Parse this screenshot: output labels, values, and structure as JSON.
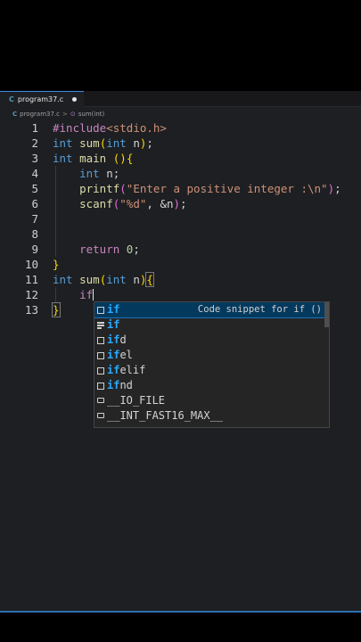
{
  "tab": {
    "icon": "C",
    "name": "program37.c"
  },
  "breadcrumb": {
    "icon": "C",
    "file": "program37.c",
    "sep": ">",
    "symbol": "sum(int)"
  },
  "lines": [
    {
      "n": "1",
      "tokens": [
        [
          "pre",
          "#include"
        ],
        [
          "inc",
          "<stdio.h>"
        ]
      ]
    },
    {
      "n": "2",
      "tokens": [
        [
          "kw",
          "int"
        ],
        [
          "txt",
          " "
        ],
        [
          "fn",
          "sum"
        ],
        [
          "br1",
          "("
        ],
        [
          "kw",
          "int"
        ],
        [
          "txt",
          " n"
        ],
        [
          "br1",
          ")"
        ],
        [
          "txt",
          ";"
        ]
      ]
    },
    {
      "n": "3",
      "tokens": [
        [
          "kw",
          "int"
        ],
        [
          "txt",
          " "
        ],
        [
          "fn",
          "main"
        ],
        [
          "txt",
          " "
        ],
        [
          "br1",
          "()"
        ],
        [
          "br1",
          "{"
        ]
      ]
    },
    {
      "n": "4",
      "tokens": [
        [
          "txt",
          "    "
        ],
        [
          "kw",
          "int"
        ],
        [
          "txt",
          " n;"
        ]
      ]
    },
    {
      "n": "5",
      "tokens": [
        [
          "txt",
          "    "
        ],
        [
          "fn",
          "printf"
        ],
        [
          "br2",
          "("
        ],
        [
          "str",
          "\"Enter a positive integer :\\n\""
        ],
        [
          "br2",
          ")"
        ],
        [
          "txt",
          ";"
        ]
      ]
    },
    {
      "n": "6",
      "tokens": [
        [
          "txt",
          "    "
        ],
        [
          "fn",
          "scanf"
        ],
        [
          "br2",
          "("
        ],
        [
          "str",
          "\"%d\""
        ],
        [
          "txt",
          ", &n"
        ],
        [
          "br2",
          ")"
        ],
        [
          "txt",
          ";"
        ]
      ]
    },
    {
      "n": "7",
      "tokens": []
    },
    {
      "n": "8",
      "tokens": []
    },
    {
      "n": "9",
      "tokens": [
        [
          "txt",
          "    "
        ],
        [
          "ctl",
          "return"
        ],
        [
          "txt",
          " "
        ],
        [
          "num",
          "0"
        ],
        [
          "txt",
          ";"
        ]
      ]
    },
    {
      "n": "10",
      "tokens": [
        [
          "br1",
          "}"
        ]
      ]
    },
    {
      "n": "11",
      "tokens": [
        [
          "kw",
          "int"
        ],
        [
          "txt",
          " "
        ],
        [
          "fn",
          "sum"
        ],
        [
          "br1",
          "("
        ],
        [
          "kw",
          "int"
        ],
        [
          "txt",
          " n"
        ],
        [
          "br1",
          ")"
        ],
        [
          "br1m",
          "{"
        ]
      ]
    },
    {
      "n": "12",
      "tokens": [
        [
          "txt",
          "    "
        ],
        [
          "ctl",
          "if"
        ],
        [
          "cursor",
          ""
        ]
      ]
    },
    {
      "n": "13",
      "tokens": [
        [
          "br1m",
          "}"
        ]
      ]
    }
  ],
  "suggestions": [
    {
      "icon": "snippet",
      "hl": "if",
      "rest": "",
      "detail": "Code snippet for if ()",
      "selected": true
    },
    {
      "icon": "keyword",
      "hl": "if",
      "rest": "",
      "detail": ""
    },
    {
      "icon": "snippet",
      "hl": "if",
      "rest": "d",
      "detail": ""
    },
    {
      "icon": "snippet",
      "hl": "if",
      "rest": "el",
      "detail": ""
    },
    {
      "icon": "snippet",
      "hl": "if",
      "rest": "elif",
      "detail": ""
    },
    {
      "icon": "snippet",
      "hl": "if",
      "rest": "nd",
      "detail": ""
    },
    {
      "icon": "variable",
      "hl": "",
      "rest": "__IO_FILE",
      "detail": ""
    },
    {
      "icon": "variable",
      "hl": "",
      "rest": "__INT_FAST16_MAX__",
      "detail": ""
    }
  ]
}
